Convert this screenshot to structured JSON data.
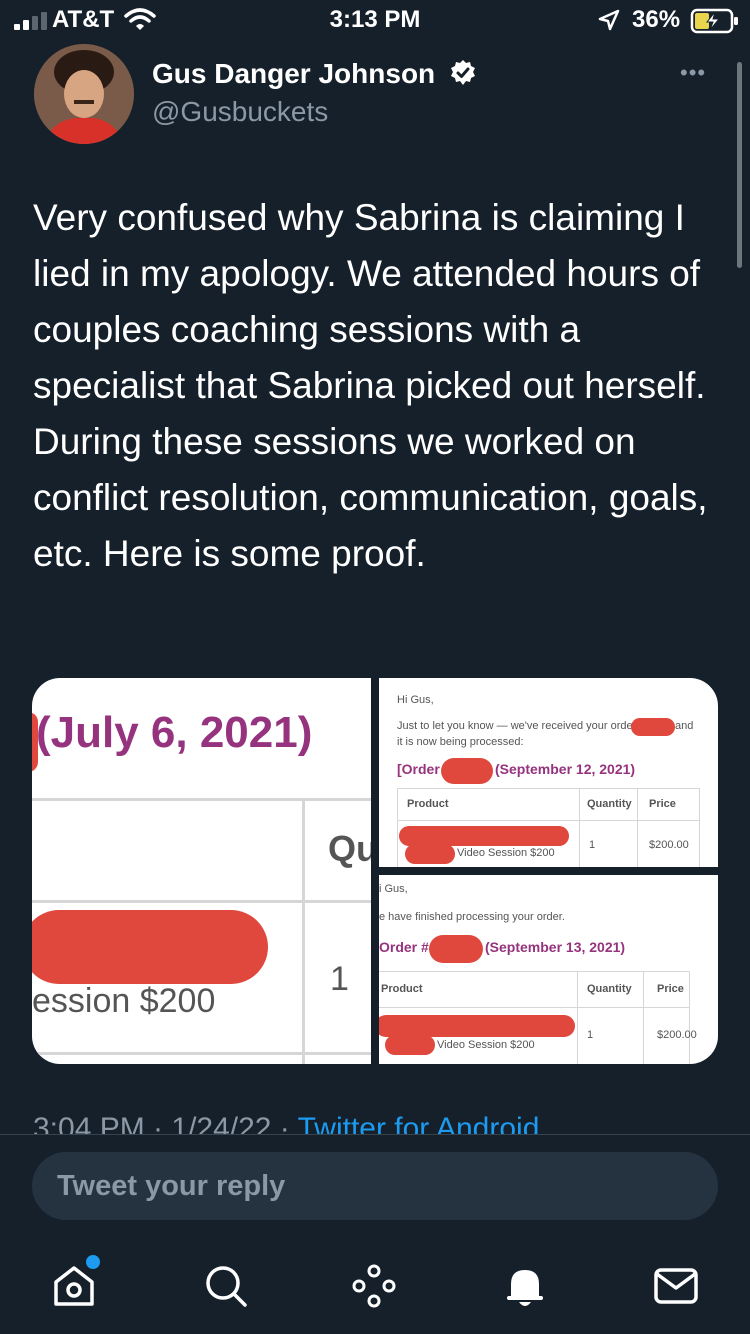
{
  "status_bar": {
    "carrier": "AT&T",
    "time": "3:13 PM",
    "battery_percent": "36%"
  },
  "tweet": {
    "author_name": "Gus Danger Johnson",
    "author_handle": "@Gusbuckets",
    "verified": true,
    "text": "Very confused why Sabrina is claiming I lied in my apology. We attended hours of couples coaching sessions with a specialist that Sabrina picked out herself. During these sessions we worked on conflict resolution, communication, goals, etc. Here is some proof.",
    "timestamp": "3:04 PM · 1/24/22 · ",
    "source": "Twitter for Android"
  },
  "media": {
    "image1": {
      "date_heading": "(July 6, 2021)",
      "col_header": "Qu",
      "quantity": "1",
      "item": "ession $200"
    },
    "image2": {
      "greeting": "Hi Gus,",
      "message_a": "Just to let you know — we've received your order",
      "message_b": "and",
      "message_c": "it is now being processed:",
      "order_prefix": "[Order",
      "order_date": "(September 12, 2021)",
      "headers": [
        "Product",
        "Quantity",
        "Price"
      ],
      "item": "Video Session $200",
      "quantity": "1",
      "price": "$200.00"
    },
    "image3": {
      "greeting": "i Gus,",
      "message": "e have finished processing your order.",
      "order_prefix": "Order #",
      "order_date": "(September 13, 2021)",
      "headers": [
        "Product",
        "Quantity",
        "Price"
      ],
      "item": "Video Session $200",
      "quantity": "1",
      "price": "$200.00"
    }
  },
  "reply": {
    "placeholder": "Tweet your reply"
  },
  "colors": {
    "background": "#15202b",
    "accent": "#1d9bf0",
    "muted": "#8b98a5",
    "redaction": "#e0483d",
    "order_purple": "#96337e"
  },
  "nav": [
    "home-icon",
    "search-icon",
    "spaces-icon",
    "notifications-icon",
    "messages-icon"
  ]
}
